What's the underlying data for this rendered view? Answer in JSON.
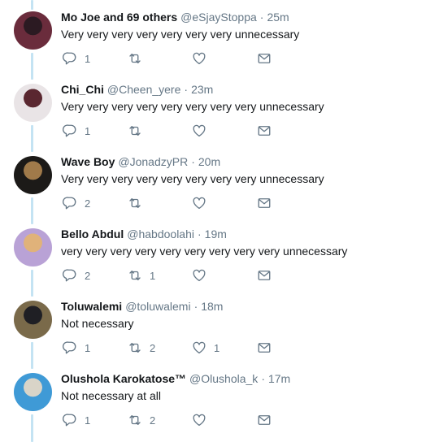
{
  "tweets": [
    {
      "name": "Mo Joe and 69 others",
      "handle": "@eSjayStoppa",
      "separator": "·",
      "time": "25m",
      "text": "Very very very very very very very unnecessary",
      "replies": "1",
      "retweets": "",
      "likes": "",
      "avatar_colors": [
        "#6a2c3c",
        "#2b1a22"
      ]
    },
    {
      "name": "Chi_Chi",
      "handle": "@Cheen_yere",
      "separator": "·",
      "time": "23m",
      "text": "Very very very very very very very very unnecessary",
      "replies": "1",
      "retweets": "",
      "likes": "",
      "avatar_colors": [
        "#e9e4e6",
        "#5a2730"
      ]
    },
    {
      "name": "Wave Boy",
      "handle": "@JonadzyPR",
      "separator": "·",
      "time": "20m",
      "text": "Very very very very very very very very unnecessary",
      "replies": "2",
      "retweets": "",
      "likes": "",
      "avatar_colors": [
        "#1c1a18",
        "#a07a4a"
      ]
    },
    {
      "name": "Bello Abdul",
      "handle": "@habdoolahi",
      "separator": "·",
      "time": "19m",
      "text": "very very very very very very very very very unnecessary",
      "replies": "2",
      "retweets": "1",
      "likes": "",
      "avatar_colors": [
        "#b9a2d6",
        "#e0b27a"
      ]
    },
    {
      "name": "Toluwalemi",
      "handle": "@toluwalemi",
      "separator": "·",
      "time": "18m",
      "text": "Not necessary",
      "replies": "1",
      "retweets": "2",
      "likes": "1",
      "avatar_colors": [
        "#7a6a4a",
        "#1f1f24"
      ]
    },
    {
      "name": "Olushola Karokatose™",
      "handle": "@Olushola_k",
      "separator": "·",
      "time": "17m",
      "text": "Not necessary at all",
      "replies": "1",
      "retweets": "2",
      "likes": "",
      "avatar_colors": [
        "#3f9ad6",
        "#d9d4c8"
      ]
    }
  ],
  "icons": {
    "reply": "reply-icon",
    "retweet": "retweet-icon",
    "like": "like-icon",
    "message": "direct-message-icon"
  },
  "colors": {
    "thread_line": "#c4e3f3",
    "secondary_text": "#657786",
    "primary_text": "#14171a"
  }
}
